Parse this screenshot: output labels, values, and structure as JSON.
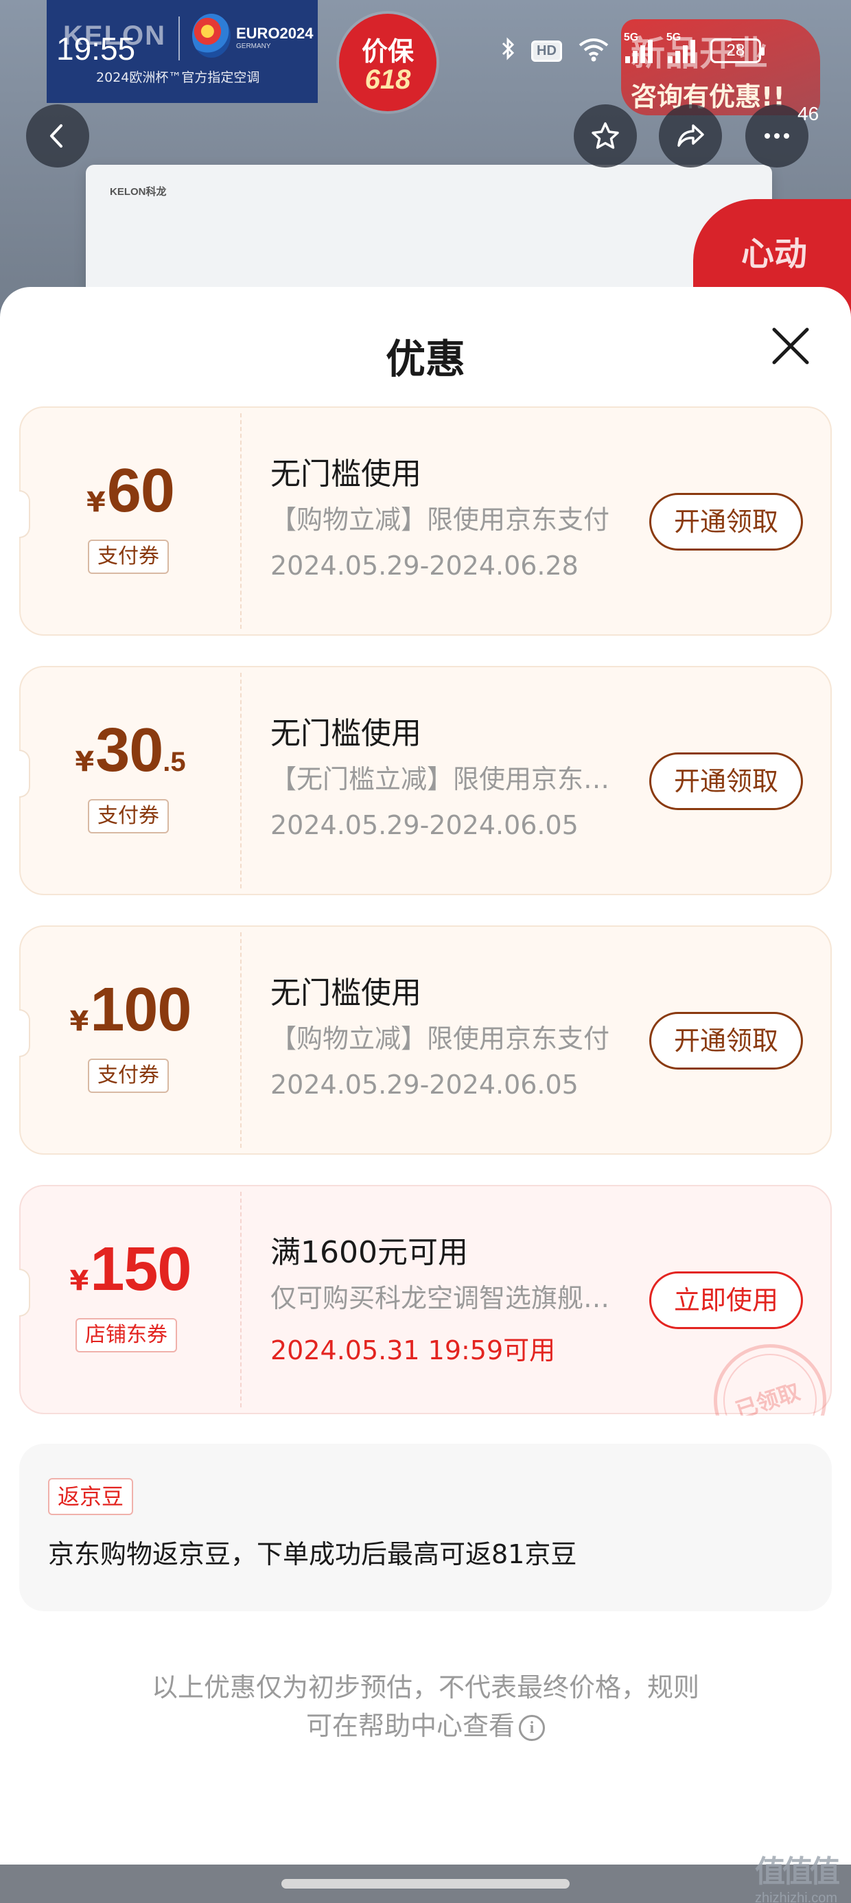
{
  "product_banner": {
    "brand": "KELON",
    "euro_label": "EURO2024",
    "euro_sub": "GERMANY",
    "slogan": "2024欧洲杯™官方指定空调",
    "badge_line1": "价保",
    "badge_line2": "618",
    "promo_line1": "新品开业",
    "promo_line2": "咨询有优惠!!",
    "unit_brand": "KELON科龙",
    "side_promo": "心动"
  },
  "status_bar": {
    "time": "19:55",
    "hd_label": "HD",
    "signal1_label": "5G",
    "signal2_label": "5G",
    "battery": "28"
  },
  "nav": {
    "message_count": "46"
  },
  "sheet": {
    "title": "优惠"
  },
  "coupons": [
    {
      "currency": "¥",
      "amount": "60",
      "decimal": "",
      "tag": "支付券",
      "title": "无门槛使用",
      "description": "【购物立减】限使用京东支付",
      "date": "2024.05.29-2024.06.28",
      "button": "开通领取"
    },
    {
      "currency": "¥",
      "amount": "30",
      "decimal": ".5",
      "tag": "支付券",
      "title": "无门槛使用",
      "description": "【无门槛立减】限使用京东支付",
      "date": "2024.05.29-2024.06.05",
      "button": "开通领取"
    },
    {
      "currency": "¥",
      "amount": "100",
      "decimal": "",
      "tag": "支付券",
      "title": "无门槛使用",
      "description": "【购物立减】限使用京东支付",
      "date": "2024.05.29-2024.06.05",
      "button": "开通领取"
    },
    {
      "currency": "¥",
      "amount": "150",
      "decimal": "",
      "tag": "店铺东券",
      "title": "满1600元可用",
      "description": "仅可购买科龙空调智选旗舰店商品",
      "date": "2024.05.31 19:59可用",
      "button": "立即使用",
      "stamp": "已领取"
    }
  ],
  "jd_beans": {
    "tag": "返京豆",
    "text": "京东购物返京豆，下单成功后最高可返81京豆"
  },
  "disclaimer": {
    "line1": "以上优惠仅为初步预估，不代表最终价格，规则",
    "line2": "可在帮助中心查看"
  },
  "watermark": {
    "mark": "值值值",
    "url": "zhizhizhi.com"
  },
  "colors": {
    "payment_coupon_accent": "#8a3a0f",
    "store_coupon_accent": "#e32420",
    "payment_coupon_bg": "#fff8f2",
    "store_coupon_bg": "#fff4f3"
  }
}
